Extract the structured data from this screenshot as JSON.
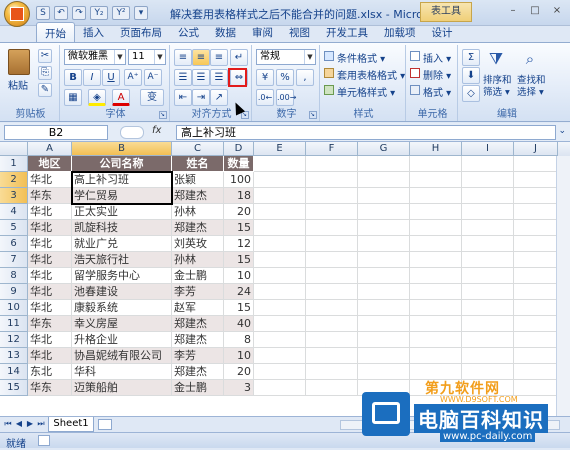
{
  "window": {
    "title": "解决套用表格样式之后不能合并的问题.xlsx - Microsoft Ex...",
    "context_tab": "表工具",
    "controls": [
      "–",
      "□",
      "×"
    ]
  },
  "qat": [
    "S",
    "↶",
    "↷",
    "Y₂",
    "Y²",
    "▾"
  ],
  "tabs": [
    "开始",
    "插入",
    "页面布局",
    "公式",
    "数据",
    "审阅",
    "视图",
    "开发工具",
    "加载项",
    "设计"
  ],
  "active_tab": "开始",
  "ribbon": {
    "clipboard": {
      "label": "剪贴板",
      "paste": "粘贴"
    },
    "font": {
      "label": "字体",
      "name": "微软雅黑",
      "size": "11",
      "bold": "B",
      "italic": "I",
      "underline": "U",
      "grow": "A⁺",
      "shrink": "A⁻",
      "wen": "变"
    },
    "align": {
      "label": "对齐方式"
    },
    "number": {
      "label": "数字",
      "format": "常规",
      "percent": "%",
      "comma": ","
    },
    "styles": {
      "label": "样式",
      "items": [
        "条件格式 ▾",
        "套用表格格式 ▾",
        "单元格样式 ▾"
      ]
    },
    "cells": {
      "label": "单元格",
      "items": [
        "插入 ▾",
        "删除 ▾",
        "格式 ▾"
      ]
    },
    "editing": {
      "label": "编辑",
      "sort": "排序和\n筛选 ▾",
      "sort1": "排序和",
      "sort2": "筛选 ▾",
      "find1": "查找和",
      "find2": "选择 ▾"
    }
  },
  "formula_bar": {
    "name_box": "B2",
    "fx": "fx",
    "content": "高上补习班"
  },
  "columns": [
    "A",
    "B",
    "C",
    "D",
    "E",
    "F",
    "G",
    "H",
    "I",
    "J"
  ],
  "selected_column": "B",
  "selected_rows": [
    "2",
    "3"
  ],
  "table": {
    "headers": [
      "地区",
      "公司名称",
      "姓名",
      "数量"
    ],
    "rows": [
      [
        "华北",
        "高上补习班",
        "张颖",
        "100"
      ],
      [
        "华东",
        "学仁贸易",
        "郑建杰",
        "18"
      ],
      [
        "华北",
        "正太实业",
        "孙林",
        "20"
      ],
      [
        "华北",
        "凯旋科技",
        "郑建杰",
        "15"
      ],
      [
        "华北",
        "就业广兑",
        "刘英玫",
        "12"
      ],
      [
        "华北",
        "浩天旅行社",
        "孙林",
        "15"
      ],
      [
        "华北",
        "留学服务中心",
        "金士鹏",
        "10"
      ],
      [
        "华北",
        "池春建设",
        "李芳",
        "24"
      ],
      [
        "华北",
        "康毅系统",
        "赵军",
        "15"
      ],
      [
        "华东",
        "幸义房屋",
        "郑建杰",
        "40"
      ],
      [
        "华北",
        "升格企业",
        "郑建杰",
        "8"
      ],
      [
        "华北",
        "协昌妮绒有限公司",
        "李芳",
        "10"
      ],
      [
        "东北",
        "华科",
        "郑建杰",
        "20"
      ],
      [
        "华东",
        "迈策船舶",
        "金士鹏",
        "3"
      ]
    ]
  },
  "row_numbers": [
    "1",
    "2",
    "3",
    "4",
    "5",
    "6",
    "7",
    "8",
    "9",
    "10",
    "11",
    "12",
    "13",
    "14",
    "15"
  ],
  "sheet_tabs": [
    "Sheet1"
  ],
  "status": "就绪",
  "watermarks": {
    "top": "第九软件网",
    "top_url": "WWW.D9SOFT.COM",
    "main": "电脑百科知识",
    "main_url": "www.pc-daily.com"
  }
}
